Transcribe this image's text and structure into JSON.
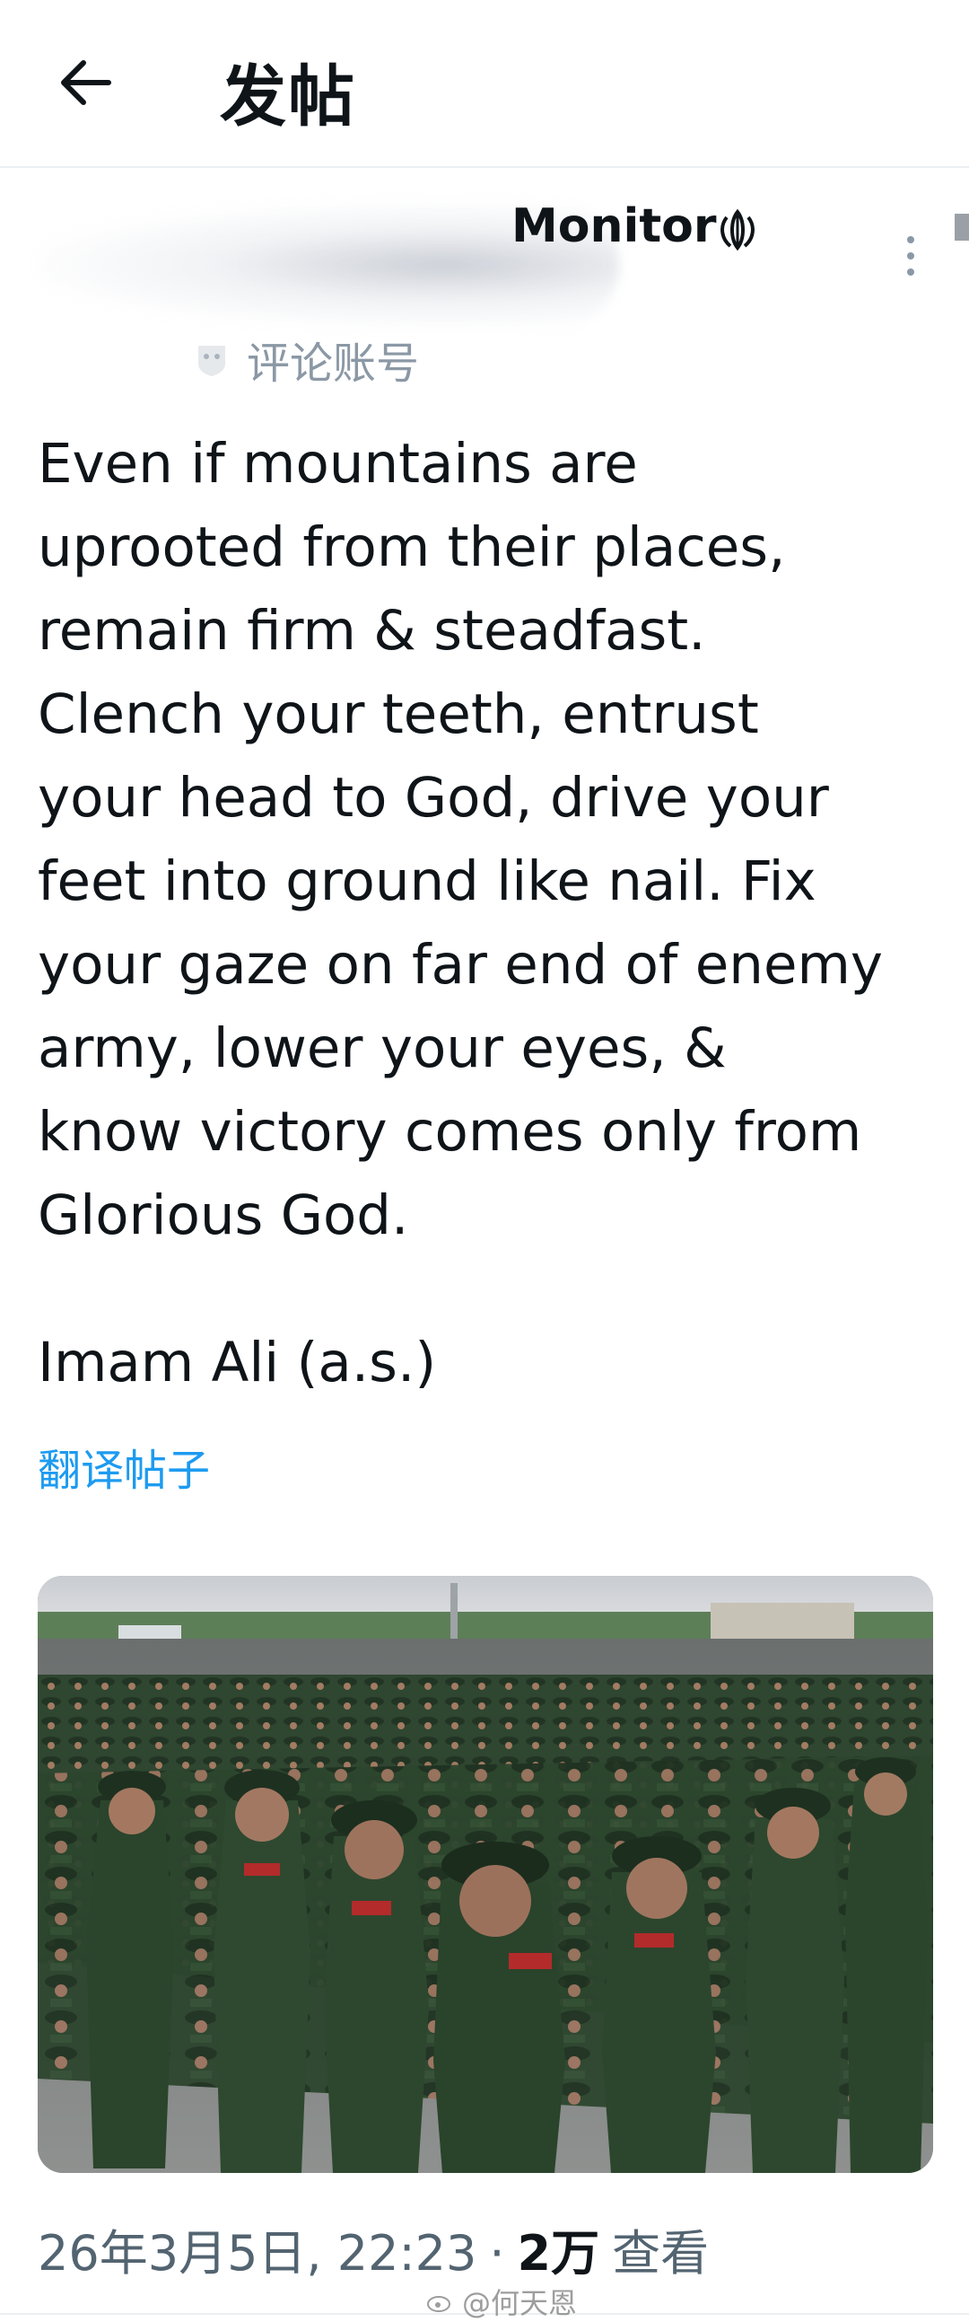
{
  "header": {
    "title": "发帖",
    "back_icon": "arrow-left-icon"
  },
  "author": {
    "display_name_partial": "Monitor",
    "badge_label": "评论账号"
  },
  "post": {
    "text": "Even if mountains are\nuprooted from their places,\nremain firm & steadfast.\nClench your teeth, entrust\nyour head to God, drive your\nfeet into ground like nail. Fix\nyour gaze on far end of enemy\narmy, lower your eyes, &\nknow victory comes only from\nGlorious God.",
    "attribution": "Imam Ali (a.s.)",
    "translate_label": "翻译帖子"
  },
  "meta": {
    "timestamp": "26年3月5日, 22:23",
    "separator": "·",
    "views_count": "2万",
    "views_label": "查看"
  },
  "watermark": "@何天恩",
  "colors": {
    "link": "#1d9bf0",
    "text": "#0f1419",
    "muted": "#536471",
    "uniform": "#2e4a2e",
    "beret_red": "#b32b2b"
  }
}
